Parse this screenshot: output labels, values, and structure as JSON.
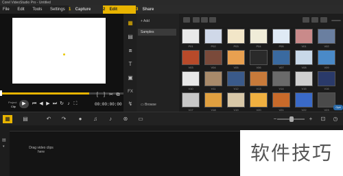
{
  "window": {
    "title": "Corel VideoStudio Pro - Untitled"
  },
  "menu": {
    "items": [
      "File",
      "Edit",
      "Tools",
      "Settings"
    ]
  },
  "steps": [
    {
      "num": "1",
      "label": "Capture"
    },
    {
      "num": "2",
      "label": "Edit"
    },
    {
      "num": "3",
      "label": "Share"
    }
  ],
  "preview": {
    "project_label": "Project",
    "clip_label": "Clip",
    "timecode": "00:00:00:00",
    "scrub_position": 0.72
  },
  "library": {
    "add_label": "Add",
    "folder_label": "Samples",
    "browse_label": "Browse",
    "options_label": "Opti",
    "thumbs": [
      {
        "label": "P01",
        "color": "#e8e8e8"
      },
      {
        "label": "P02",
        "color": "#cfd8e8"
      },
      {
        "label": "P03",
        "color": "#f2e6c8"
      },
      {
        "label": "P04",
        "color": "#f0ecd8"
      },
      {
        "label": "P05",
        "color": "#dfeaf5"
      },
      {
        "label": "V01",
        "color": "#c98a8a"
      },
      {
        "label": "V02",
        "color": "#6a7fa0"
      },
      {
        "label": "V03",
        "color": "#b84a2a"
      },
      {
        "label": "V04",
        "color": "#7a4a3a"
      },
      {
        "label": "V05",
        "color": "#e8a050"
      },
      {
        "label": "V06",
        "color": "#2a2a2a"
      },
      {
        "label": "V07",
        "color": "#3a6aa0"
      },
      {
        "label": "V08",
        "color": "#c8d8e8"
      },
      {
        "label": "V09",
        "color": "#4a8ac8"
      },
      {
        "label": "V10",
        "color": "#e8e8e8"
      },
      {
        "label": "V11",
        "color": "#a88a6a"
      },
      {
        "label": "V12",
        "color": "#3a5a8a"
      },
      {
        "label": "V13",
        "color": "#c87a3a"
      },
      {
        "label": "V14",
        "color": "#6a6a6a"
      },
      {
        "label": "V15",
        "color": "#d0d0d0"
      },
      {
        "label": "V16",
        "color": "#2a3a6a"
      },
      {
        "label": "V17",
        "color": "#c8c8c8"
      },
      {
        "label": "V18",
        "color": "#e0a040"
      },
      {
        "label": "V19",
        "color": "#d8c8a8"
      },
      {
        "label": "V20",
        "color": "#f0b040"
      },
      {
        "label": "V21",
        "color": "#c86a2a"
      },
      {
        "label": "V22",
        "color": "#3a6ac8"
      },
      {
        "label": "V23",
        "color": "#4a4a4a"
      }
    ]
  },
  "timeline": {
    "drag_hint": "Drag video clips here"
  },
  "watermark": {
    "text": "软件技巧"
  },
  "colors": {
    "accent": "#e8b400",
    "options": "#2a6aa8"
  }
}
